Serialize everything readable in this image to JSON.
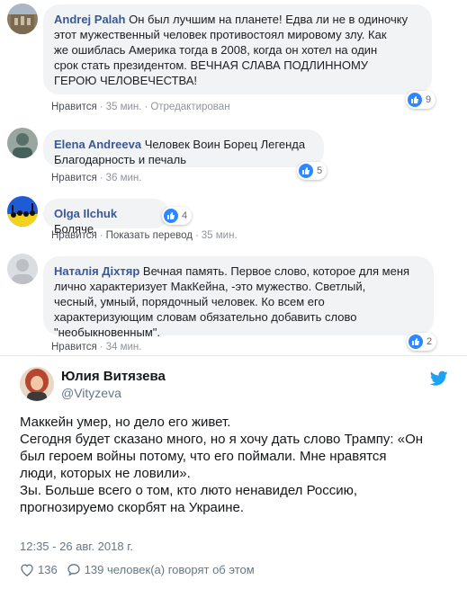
{
  "comments": [
    {
      "author": "Andrej Palah",
      "lines": [
        "Он был лучшим на планете! Едва ли не в одиночку",
        "этот мужественный человек противостоял мировому злу. Как",
        "же ошиблась Америка тогда в 2008, когда он хотел на один",
        "срок стать президентом. ВЕЧНАЯ СЛАВА ПОДЛИННОМУ",
        "ГЕРОЮ ЧЕЛОВЕЧЕСТВА!"
      ],
      "likes": "9",
      "like_label": "Нравится",
      "time": "35 мин.",
      "extra": "Отредактирован"
    },
    {
      "author": "Elena Andreeva",
      "lines": [
        "Человек Воин Борец Легенда",
        "Благодарность и печаль"
      ],
      "likes": "5",
      "like_label": "Нравится",
      "time": "36 мин."
    },
    {
      "author": "Olga Ilchuk",
      "lines": [
        "Боляче."
      ],
      "likes": "4",
      "like_label": "Нравится",
      "translate_label": "Показать перевод",
      "time": "35 мин."
    },
    {
      "author": "Наталія Діхтяр",
      "lines": [
        "Вечная память. Первое слово, которое для меня",
        "лично характеризует МакКейна, -это мужество. Светлый,",
        "чесный, умный, порядочный человек. Ко всем его",
        "характеризующим словам обязательно добавить слово",
        "\"необыкновенным\"."
      ],
      "likes": "2",
      "like_label": "Нравится",
      "time": "34 мин."
    }
  ],
  "tweet": {
    "name": "Юлия Витязева",
    "handle": "@Vityzeva",
    "lines": [
      "Маккейн умер, но дело его живет.",
      "Сегодня будет сказано много, но я хочу дать слово Трампу: «Он",
      "был героем войны потому, что его поймали. Мне нравятся",
      "люди, которых не ловили».",
      "Зы. Больше всего о том, кто люто ненавидел Россию,",
      "прогнозируемо скорбят на Украине."
    ],
    "date": "12:35 - 26 авг. 2018 г.",
    "likes": "136",
    "replies_text": "139 человек(а) говорят об этом"
  },
  "colors": {
    "fb_link": "#385898",
    "bubble_bg": "#f2f3f5",
    "like_blue": "#2d88ff",
    "twitter_blue": "#1da1f2",
    "tweet_gray": "#657786"
  },
  "icons": [
    "like-icon",
    "twitter-bird-icon",
    "heart-icon",
    "speech-bubble-icon"
  ]
}
